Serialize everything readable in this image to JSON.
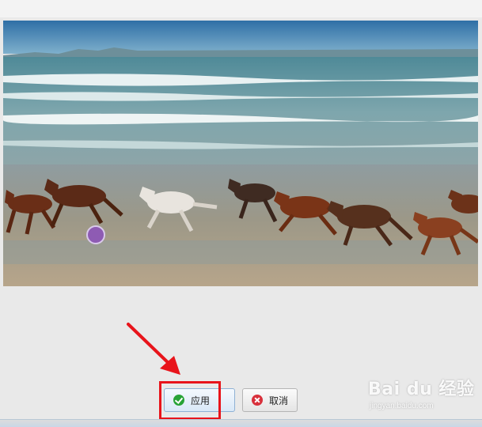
{
  "preview": {
    "subject": "horses running on beach",
    "colors": {
      "sky": "#3f7fb0",
      "sea": "#6f9aa8",
      "sand": "#a89a86"
    }
  },
  "actions": {
    "apply_label": "应用",
    "apply_icon": "check-circle-icon",
    "cancel_label": "取消",
    "cancel_icon": "close-circle-icon"
  },
  "annotation": {
    "color": "#e8141b"
  },
  "watermark": {
    "logo_text": "Bai du 经验",
    "url": "jingyan.baidu.com"
  }
}
